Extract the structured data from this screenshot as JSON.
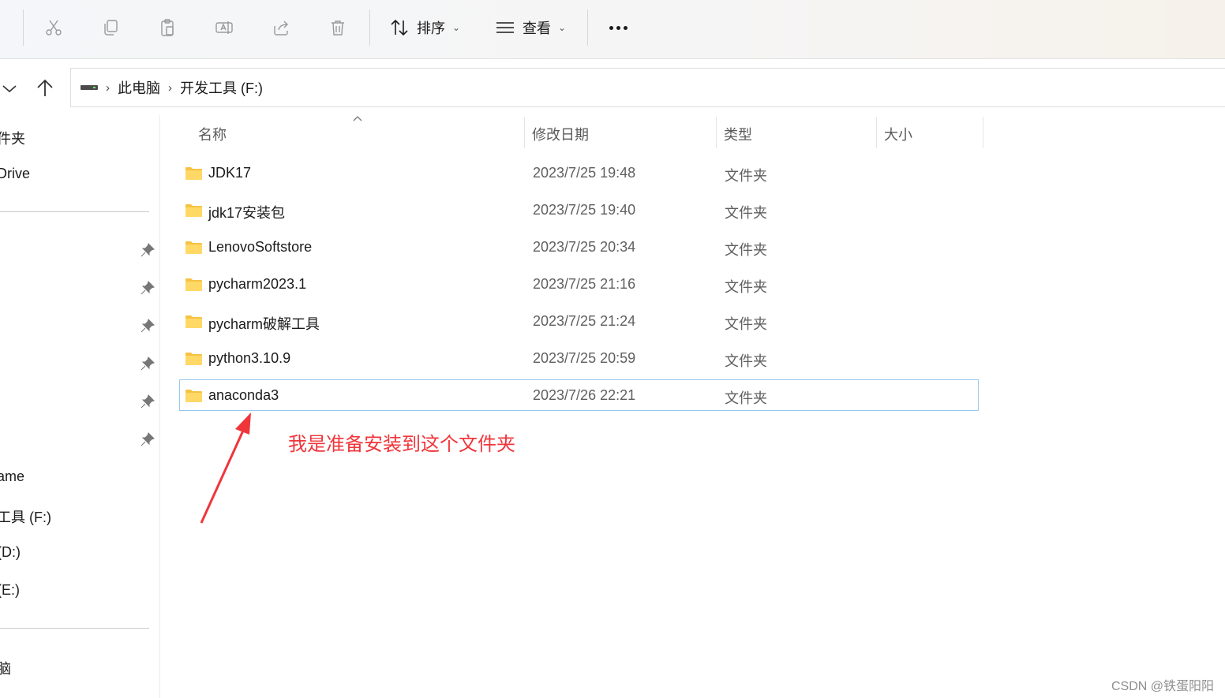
{
  "toolbar": {
    "icons": [
      "cut-icon",
      "copy-icon",
      "paste-icon",
      "rename-icon",
      "share-icon",
      "delete-icon"
    ],
    "sort_label": "排序",
    "view_label": "查看",
    "more_icon": "more-icon"
  },
  "address": {
    "crumbs": [
      "此电脑",
      "开发工具 (F:)"
    ]
  },
  "sidebar": {
    "items": [
      {
        "label": "件夹"
      },
      {
        "label": "Drive"
      },
      {
        "label": "ame"
      },
      {
        "label": "工具 (F:)"
      },
      {
        "label": " (D:)"
      },
      {
        "label": "(E:)"
      },
      {
        "label": "脑"
      }
    ],
    "pinned_count": 6
  },
  "columns": {
    "name": "名称",
    "modified": "修改日期",
    "type": "类型",
    "size": "大小"
  },
  "files": [
    {
      "name": "JDK17",
      "modified": "2023/7/25 19:48",
      "type": "文件夹"
    },
    {
      "name": "jdk17安装包",
      "modified": "2023/7/25 19:40",
      "type": "文件夹"
    },
    {
      "name": "LenovoSoftstore",
      "modified": "2023/7/25 20:34",
      "type": "文件夹"
    },
    {
      "name": "pycharm2023.1",
      "modified": "2023/7/25 21:16",
      "type": "文件夹"
    },
    {
      "name": "pycharm破解工具",
      "modified": "2023/7/25 21:24",
      "type": "文件夹"
    },
    {
      "name": "python3.10.9",
      "modified": "2023/7/25 20:59",
      "type": "文件夹"
    },
    {
      "name": "anaconda3",
      "modified": "2023/7/26 22:21",
      "type": "文件夹",
      "selected": true
    }
  ],
  "annotation": {
    "text": "我是准备安装到这个文件夹",
    "color": "#f0353a"
  },
  "watermark": "CSDN @铁蛋阳阳"
}
